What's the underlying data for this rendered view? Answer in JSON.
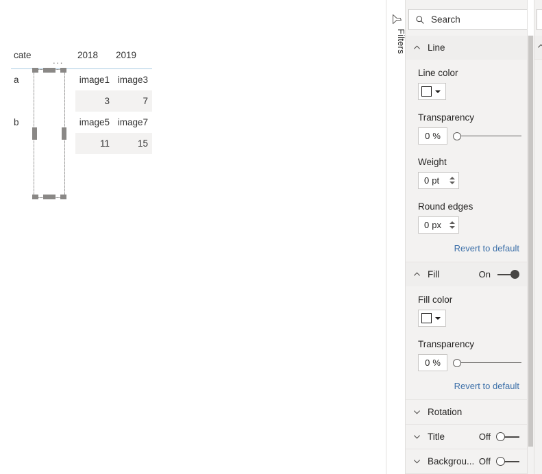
{
  "canvas": {
    "matrix": {
      "headers": [
        "cate",
        "...",
        "2018",
        "2019"
      ],
      "rows": [
        {
          "category": "a",
          "shaded": false,
          "cells": [
            "image1",
            "image3"
          ]
        },
        {
          "category": "",
          "shaded": true,
          "cells": [
            "3",
            "7"
          ]
        },
        {
          "category": "b",
          "shaded": false,
          "cells": [
            "image5",
            "image7"
          ]
        },
        {
          "category": "",
          "shaded": true,
          "cells": [
            "11",
            "15"
          ]
        }
      ]
    },
    "selected_shape": {
      "name": "selected-shape"
    }
  },
  "filters_rail": {
    "label": "Filters",
    "icon": "filter-funnel-icon"
  },
  "format_pane": {
    "search": {
      "placeholder": "Search",
      "value": "",
      "icon": "search-icon"
    },
    "sections": [
      {
        "id": "line",
        "title": "Line",
        "expanded": true,
        "chevron": "chevron-up-icon",
        "toggle": null,
        "fields": [
          {
            "type": "color",
            "label": "Line color",
            "swatch": "#ffffff"
          },
          {
            "type": "slider",
            "label": "Transparency",
            "value": "0",
            "unit": "%",
            "percent": 0
          },
          {
            "type": "spinner",
            "label": "Weight",
            "value": "0",
            "unit": "pt"
          },
          {
            "type": "spinner",
            "label": "Round edges",
            "value": "0",
            "unit": "px"
          }
        ],
        "revert": "Revert to default"
      },
      {
        "id": "fill",
        "title": "Fill",
        "expanded": true,
        "chevron": "chevron-up-icon",
        "toggle": {
          "state": "On",
          "on": true
        },
        "fields": [
          {
            "type": "color",
            "label": "Fill color",
            "swatch": "#ffffff"
          },
          {
            "type": "slider",
            "label": "Transparency",
            "value": "0",
            "unit": "%",
            "percent": 0
          }
        ],
        "revert": "Revert to default"
      },
      {
        "id": "rotation",
        "title": "Rotation",
        "expanded": false,
        "chevron": "chevron-down-icon",
        "toggle": null,
        "fields": [],
        "revert": null
      },
      {
        "id": "title",
        "title": "Title",
        "expanded": false,
        "chevron": "chevron-down-icon",
        "toggle": {
          "state": "Off",
          "on": false
        },
        "fields": [],
        "revert": null
      },
      {
        "id": "background",
        "title": "Backgrou...",
        "expanded": false,
        "chevron": "chevron-down-icon",
        "toggle": {
          "state": "Off",
          "on": false
        },
        "fields": [],
        "revert": null
      }
    ]
  },
  "colors": {
    "pane_bg": "#f3f2f1",
    "section_header_bg": "#efeeed",
    "link": "#3b6fa8",
    "matrix_rule": "#a6c9e2",
    "row_shade": "#f3f2f1",
    "handle": "#8a8886"
  }
}
